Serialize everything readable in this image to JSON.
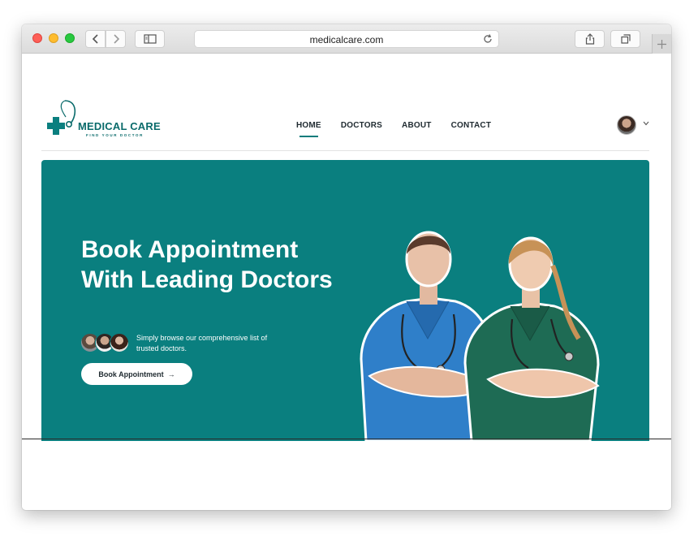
{
  "browser": {
    "url": "medicalcare.com"
  },
  "logo": {
    "title": "MEDICAL CARE",
    "subtitle": "FIND YOUR DOCTOR",
    "brand_color": "#0a6b6b"
  },
  "nav": {
    "items": [
      {
        "label": "HOME",
        "active": true
      },
      {
        "label": "DOCTORS",
        "active": false
      },
      {
        "label": "ABOUT",
        "active": false
      },
      {
        "label": "CONTACT",
        "active": false
      }
    ]
  },
  "hero": {
    "title": "Book Appointment With Leading Doctors",
    "description": "Simply browse our comprehensive list of trusted doctors.",
    "button_label": "Book Appointment",
    "button_arrow": "→",
    "background_color": "#0a7f7f"
  },
  "icons": [
    "back-icon",
    "forward-icon",
    "sidebar-icon",
    "reload-icon",
    "share-icon",
    "tabs-icon",
    "new-tab-icon",
    "chevron-down-icon",
    "arrow-right-icon"
  ]
}
